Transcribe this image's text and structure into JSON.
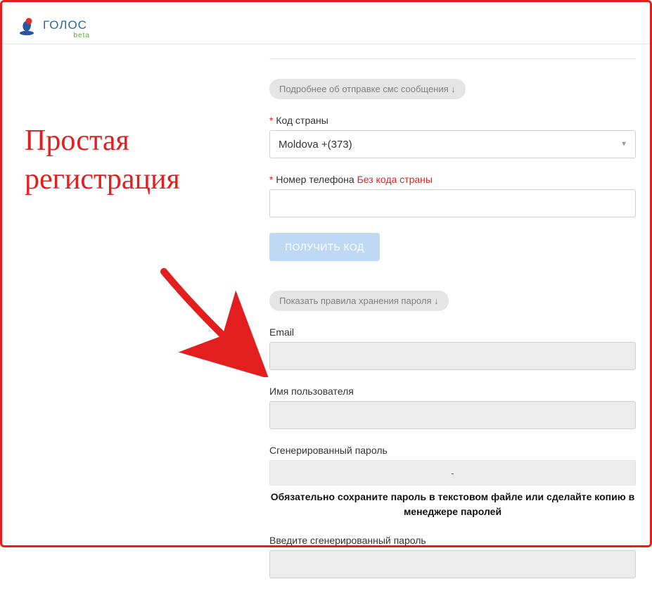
{
  "brand": {
    "name": "ГОЛОС",
    "beta": "beta"
  },
  "annotation": {
    "line1": "Простая",
    "line2": "регистрация"
  },
  "form": {
    "smsInfoPill": "Подробнее об отправке смс сообщения ↓",
    "countryCode": {
      "label": "Код страны",
      "selected": "Moldova +(373)"
    },
    "phone": {
      "label": "Номер телефона",
      "hint": "Без кода страны",
      "value": ""
    },
    "getCodeBtn": "ПОЛУЧИТЬ КОД",
    "passwordRulesPill": "Показать правила хранения пароля ↓",
    "email": {
      "label": "Email",
      "value": ""
    },
    "username": {
      "label": "Имя пользователя",
      "value": ""
    },
    "genPassword": {
      "label": "Сгенерированный пароль",
      "value": "-"
    },
    "passwordWarning": "Обязательно сохраните пароль в текстовом файле или сделайте копию в менеджере паролей",
    "enterGenPassword": {
      "label": "Введите сгенерированный пароль",
      "value": ""
    }
  }
}
